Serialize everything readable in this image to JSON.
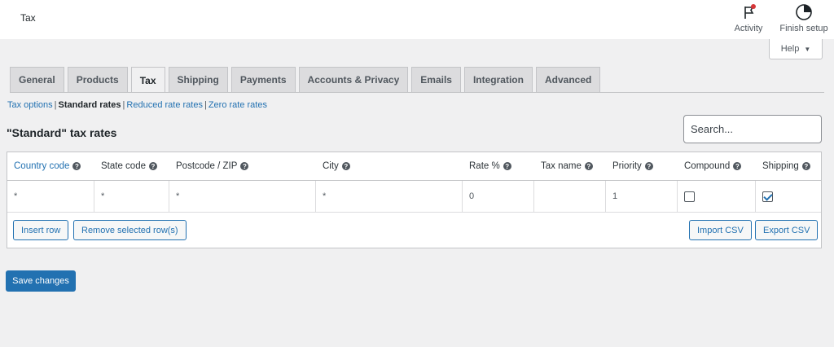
{
  "header": {
    "title": "Tax",
    "activity_label": "Activity",
    "finish_setup_label": "Finish setup",
    "help_label": "Help"
  },
  "tabs": [
    "General",
    "Products",
    "Tax",
    "Shipping",
    "Payments",
    "Accounts & Privacy",
    "Emails",
    "Integration",
    "Advanced"
  ],
  "active_tab": "Tax",
  "subnav": {
    "tax_options": "Tax options",
    "standard_rates": "Standard rates",
    "reduced_rates": "Reduced rate rates",
    "zero_rates": "Zero rate rates"
  },
  "section": {
    "title": "\"Standard\" tax rates",
    "search_placeholder": "Search..."
  },
  "table": {
    "columns": [
      "Country code",
      "State code",
      "Postcode / ZIP",
      "City",
      "Rate %",
      "Tax name",
      "Priority",
      "Compound",
      "Shipping"
    ],
    "row": {
      "country": "*",
      "state": "*",
      "postcode": "*",
      "city": "*",
      "rate": "0",
      "tax_name": "",
      "priority": "1",
      "compound": false,
      "shipping": true
    }
  },
  "buttons": {
    "insert_row": "Insert row",
    "remove_rows": "Remove selected row(s)",
    "import_csv": "Import CSV",
    "export_csv": "Export CSV",
    "save_changes": "Save changes"
  },
  "colors": {
    "accent": "#2271b1",
    "badge_red": "#d63638"
  }
}
